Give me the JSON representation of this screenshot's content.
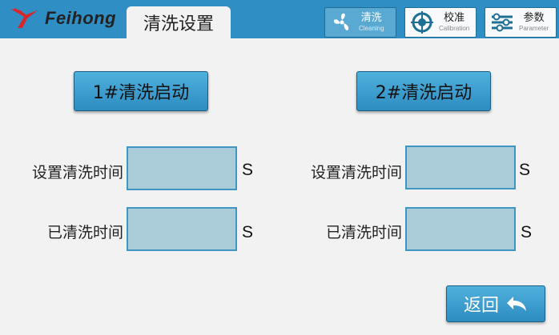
{
  "header": {
    "logo_text": "Feihong",
    "page_title": "清洗设置"
  },
  "nav": [
    {
      "cn": "清洗",
      "en": "Cleaning",
      "icon": "fan-icon"
    },
    {
      "cn": "校准",
      "en": "Calibration",
      "icon": "target-icon"
    },
    {
      "cn": "参数",
      "en": "Parameter",
      "icon": "sliders-icon"
    }
  ],
  "group1": {
    "start_label": "1#清洗启动",
    "set_time_label": "设置清洗时间",
    "elapsed_label": "已清洗时间",
    "unit": "S",
    "set_time_value": "",
    "elapsed_value": ""
  },
  "group2": {
    "start_label": "2#清洗启动",
    "set_time_label": "设置清洗时间",
    "elapsed_label": "已清洗时间",
    "unit": "S",
    "set_time_value": "",
    "elapsed_value": ""
  },
  "back_label": "返回",
  "colors": {
    "header": "#2f8fc4",
    "button": "#3a9dd0",
    "field": "#a9ccd8",
    "logo_red": "#d8262e"
  }
}
